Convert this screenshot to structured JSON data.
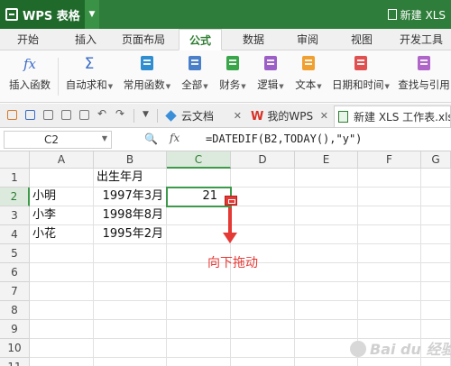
{
  "titlebar": {
    "app_name": "WPS 表格",
    "new_doc_label": "新建 XLS"
  },
  "ribbon_tabs": [
    "开始",
    "插入",
    "页面布局",
    "公式",
    "数据",
    "审阅",
    "视图",
    "开发工具"
  ],
  "active_tab": "公式",
  "ribbon": {
    "insert_function": "插入函数",
    "autosum": "自动求和",
    "common_functions": "常用函数",
    "all": "全部",
    "financial": "财务",
    "logical": "逻辑",
    "text": "文本",
    "date_time": "日期和时间",
    "lookup": "查找与引用"
  },
  "doc_tabs": [
    {
      "label": "云文档"
    },
    {
      "label": "我的WPS"
    },
    {
      "label": "新建 XLS 工作表.xls"
    }
  ],
  "formula_bar": {
    "name_box": "C2",
    "fx_label": "fx",
    "formula": "=DATEDIF(B2,TODAY(),\"y\")"
  },
  "grid": {
    "columns": [
      "A",
      "B",
      "C",
      "D",
      "E",
      "F",
      "G"
    ],
    "rows": [
      "1",
      "2",
      "3",
      "4",
      "5",
      "6",
      "7",
      "8",
      "9",
      "10",
      "11"
    ],
    "cells": {
      "B1": "出生年月",
      "A2": "小明",
      "B2": "1997年3月",
      "C2": "21",
      "A3": "小李",
      "B3": "1998年8月",
      "A4": "小花",
      "B4": "1995年2月"
    },
    "selected_cell": "C2"
  },
  "annotation": {
    "text": "向下拖动",
    "color": "#e53935"
  },
  "watermark": "Bai du 经验",
  "colors": {
    "title_green": "#2f7d3a",
    "selection_green": "#3c9a4a",
    "annotation_red": "#e53935"
  }
}
